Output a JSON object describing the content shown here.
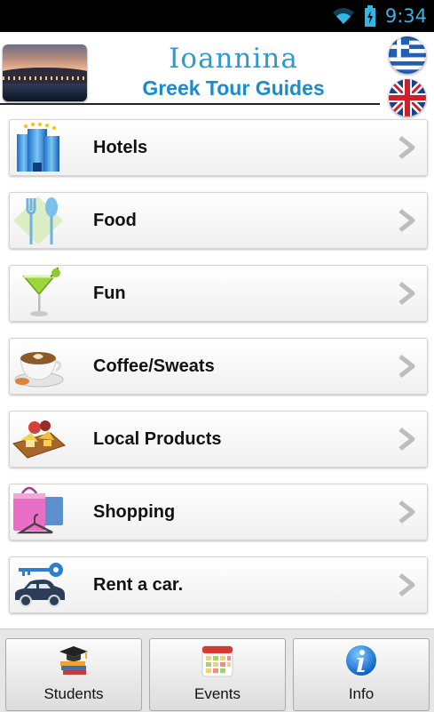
{
  "status_bar": {
    "time": "9:34"
  },
  "header": {
    "title": "Ioannina",
    "subtitle": "Greek Tour Guides"
  },
  "languages": [
    {
      "name": "greek-flag-icon"
    },
    {
      "name": "uk-flag-icon"
    }
  ],
  "menu": {
    "items": [
      {
        "label": "Hotels",
        "icon": "hotel-icon"
      },
      {
        "label": "Food",
        "icon": "cutlery-icon"
      },
      {
        "label": "Fun",
        "icon": "cocktail-icon"
      },
      {
        "label": "Coffee/Sweats",
        "icon": "coffee-cup-icon"
      },
      {
        "label": "Local Products",
        "icon": "cheese-board-icon"
      },
      {
        "label": "Shopping",
        "icon": "shopping-bag-icon"
      },
      {
        "label": "Rent a car.",
        "icon": "car-key-icon"
      }
    ]
  },
  "tabs": [
    {
      "label": "Students",
      "icon": "graduation-cap-books-icon"
    },
    {
      "label": "Events",
      "icon": "calendar-icon"
    },
    {
      "label": "Info",
      "icon": "info-icon"
    }
  ],
  "colors": {
    "accent": "#33b5e5",
    "title": "#2b9bd1",
    "subtitle": "#1a8bd0"
  }
}
